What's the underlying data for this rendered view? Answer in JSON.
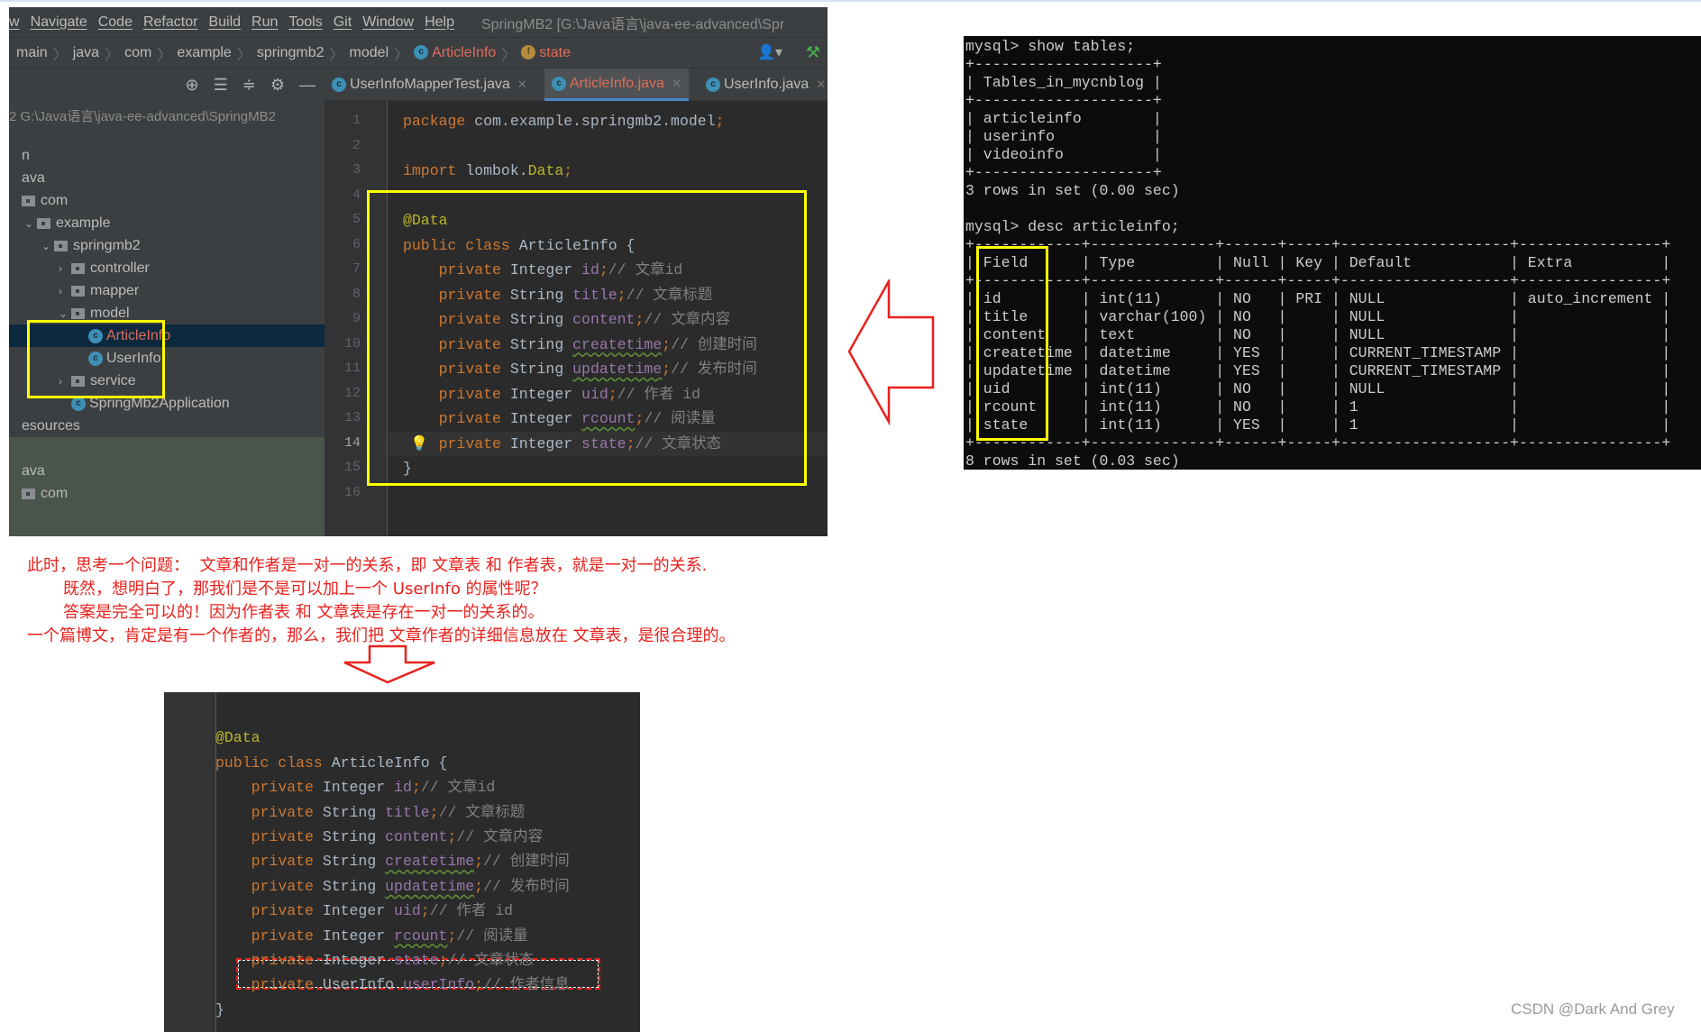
{
  "ide": {
    "menu": [
      "w",
      "Navigate",
      "Code",
      "Refactor",
      "Build",
      "Run",
      "Tools",
      "Git",
      "Window",
      "Help"
    ],
    "window_title": "SpringMB2 [G:\\Java语言\\java-ee-advanced\\Spr",
    "breadcrumb": [
      "main",
      "java",
      "com",
      "example",
      "springmb2",
      "model"
    ],
    "breadcrumb_class": "ArticleInfo",
    "breadcrumb_field": "state",
    "tabs": [
      {
        "label": "UserInfoMapperTest.java",
        "active": false
      },
      {
        "label": "ArticleInfo.java",
        "active": true
      },
      {
        "label": "UserInfo.java",
        "active": false
      }
    ],
    "project_path": "2  G:\\Java语言\\java-ee-advanced\\SpringMB2",
    "tree": [
      {
        "label": "n",
        "depth": 0,
        "kind": "text"
      },
      {
        "label": "ava",
        "depth": 0,
        "kind": "text"
      },
      {
        "label": "com",
        "depth": 0,
        "kind": "folder"
      },
      {
        "label": "example",
        "depth": 1,
        "kind": "folder",
        "chev": "open"
      },
      {
        "label": "springmb2",
        "depth": 2,
        "kind": "folder",
        "chev": "open"
      },
      {
        "label": "controller",
        "depth": 3,
        "kind": "folder",
        "chev": "closed"
      },
      {
        "label": "mapper",
        "depth": 3,
        "kind": "folder",
        "chev": "closed"
      },
      {
        "label": "model",
        "depth": 3,
        "kind": "folder",
        "chev": "open"
      },
      {
        "label": "ArticleInfo",
        "depth": 4,
        "kind": "class",
        "selected": true
      },
      {
        "label": "UserInfo",
        "depth": 4,
        "kind": "class"
      },
      {
        "label": "service",
        "depth": 3,
        "kind": "folder",
        "chev": "closed"
      },
      {
        "label": "SpringMb2Application",
        "depth": 3,
        "kind": "class"
      },
      {
        "label": "esources",
        "depth": 0,
        "kind": "text"
      },
      {
        "label": "",
        "depth": 0,
        "kind": "text"
      },
      {
        "label": "ava",
        "depth": 0,
        "kind": "text"
      },
      {
        "label": "com",
        "depth": 0,
        "kind": "folder"
      }
    ],
    "current_line": 14,
    "code": [
      [
        [
          "kw",
          "package"
        ],
        [
          "pl",
          " com.example.springmb2.model"
        ],
        [
          "kw",
          ";"
        ]
      ],
      [],
      [
        [
          "kw",
          "import"
        ],
        [
          "pl",
          " lombok."
        ],
        [
          "an",
          "Data"
        ],
        [
          "kw",
          ";"
        ]
      ],
      [],
      [
        [
          "an",
          "@Data"
        ]
      ],
      [
        [
          "kw",
          "public class "
        ],
        [
          "pl",
          "ArticleInfo {"
        ]
      ],
      [
        [
          "pl",
          "    "
        ],
        [
          "kw",
          "private "
        ],
        [
          "pl",
          "Integer "
        ],
        [
          "fd",
          "id"
        ],
        [
          "kw",
          ";"
        ],
        [
          "cm",
          "// 文章id"
        ]
      ],
      [
        [
          "pl",
          "    "
        ],
        [
          "kw",
          "private "
        ],
        [
          "pl",
          "String "
        ],
        [
          "fd",
          "title"
        ],
        [
          "kw",
          ";"
        ],
        [
          "cm",
          "// 文章标题"
        ]
      ],
      [
        [
          "pl",
          "    "
        ],
        [
          "kw",
          "private "
        ],
        [
          "pl",
          "String "
        ],
        [
          "fd",
          "content"
        ],
        [
          "kw",
          ";"
        ],
        [
          "cm",
          "// 文章内容"
        ]
      ],
      [
        [
          "pl",
          "    "
        ],
        [
          "kw",
          "private "
        ],
        [
          "pl",
          "String "
        ],
        [
          "fd typo",
          "createtime"
        ],
        [
          "kw",
          ";"
        ],
        [
          "cm",
          "// 创建时间"
        ]
      ],
      [
        [
          "pl",
          "    "
        ],
        [
          "kw",
          "private "
        ],
        [
          "pl",
          "String "
        ],
        [
          "fd typo",
          "updatetime"
        ],
        [
          "kw",
          ";"
        ],
        [
          "cm",
          "// 发布时间"
        ]
      ],
      [
        [
          "pl",
          "    "
        ],
        [
          "kw",
          "private "
        ],
        [
          "pl",
          "Integer "
        ],
        [
          "fd",
          "uid"
        ],
        [
          "kw",
          ";"
        ],
        [
          "cm",
          "// 作者 id"
        ]
      ],
      [
        [
          "pl",
          "    "
        ],
        [
          "kw",
          "private "
        ],
        [
          "pl",
          "Integer "
        ],
        [
          "fd typo",
          "rcount"
        ],
        [
          "kw",
          ";"
        ],
        [
          "cm",
          "// 阅读量"
        ]
      ],
      [
        [
          "pl",
          "    "
        ],
        [
          "kw",
          "private "
        ],
        [
          "pl",
          "Integer "
        ],
        [
          "fd",
          "state"
        ],
        [
          "kw",
          ";"
        ],
        [
          "cm",
          "// 文章状态"
        ]
      ],
      [
        [
          "pl",
          "}"
        ]
      ],
      []
    ]
  },
  "terminal": {
    "lines": [
      "mysql> show tables;",
      "+--------------------+",
      "| Tables_in_mycnblog |",
      "+--------------------+",
      "| articleinfo        |",
      "| userinfo           |",
      "| videoinfo          |",
      "+--------------------+",
      "3 rows in set (0.00 sec)",
      "",
      "mysql> desc articleinfo;",
      "+------------+--------------+------+-----+-------------------+----------------+",
      "| Field      | Type         | Null | Key | Default           | Extra          |",
      "+------------+--------------+------+-----+-------------------+----------------+",
      "| id         | int(11)      | NO   | PRI | NULL              | auto_increment |",
      "| title      | varchar(100) | NO   |     | NULL              |                |",
      "| content    | text         | NO   |     | NULL              |                |",
      "| createtime | datetime     | YES  |     | CURRENT_TIMESTAMP |                |",
      "| updatetime | datetime     | YES  |     | CURRENT_TIMESTAMP |                |",
      "| uid        | int(11)      | NO   |     | NULL              |                |",
      "| rcount     | int(11)      | NO   |     | 1                 |                |",
      "| state      | int(11)      | YES  |     | 1                 |                |",
      "+------------+--------------+------+-----+-------------------+----------------+",
      "8 rows in set (0.03 sec)"
    ]
  },
  "notes": [
    "此时，思考一个问题：  文章和作者是一对一的关系，即 文章表 和 作者表，就是一对一的关系.",
    "       既然，想明白了，那我们是不是可以加上一个 UserInfo 的属性呢？",
    "       答案是完全可以的！因为作者表 和 文章表是存在一对一的关系的。",
    "一个篇博文，肯定是有一个作者的，那么，我们把 文章作者的详细信息放在 文章表，是很合理的。"
  ],
  "code2": [
    [],
    [
      [
        "an",
        "@Data"
      ]
    ],
    [
      [
        "kw",
        "public class "
      ],
      [
        "pl",
        "ArticleInfo {"
      ]
    ],
    [
      [
        "pl",
        "    "
      ],
      [
        "kw",
        "private "
      ],
      [
        "pl",
        "Integer "
      ],
      [
        "fd",
        "id"
      ],
      [
        "kw",
        ";"
      ],
      [
        "cm",
        "// 文章id"
      ]
    ],
    [
      [
        "pl",
        "    "
      ],
      [
        "kw",
        "private "
      ],
      [
        "pl",
        "String "
      ],
      [
        "fd",
        "title"
      ],
      [
        "kw",
        ";"
      ],
      [
        "cm",
        "// 文章标题"
      ]
    ],
    [
      [
        "pl",
        "    "
      ],
      [
        "kw",
        "private "
      ],
      [
        "pl",
        "String "
      ],
      [
        "fd",
        "content"
      ],
      [
        "kw",
        ";"
      ],
      [
        "cm",
        "// 文章内容"
      ]
    ],
    [
      [
        "pl",
        "    "
      ],
      [
        "kw",
        "private "
      ],
      [
        "pl",
        "String "
      ],
      [
        "fd typo",
        "createtime"
      ],
      [
        "kw",
        ";"
      ],
      [
        "cm",
        "// 创建时间"
      ]
    ],
    [
      [
        "pl",
        "    "
      ],
      [
        "kw",
        "private "
      ],
      [
        "pl",
        "String "
      ],
      [
        "fd typo",
        "updatetime"
      ],
      [
        "kw",
        ";"
      ],
      [
        "cm",
        "// 发布时间"
      ]
    ],
    [
      [
        "pl",
        "    "
      ],
      [
        "kw",
        "private "
      ],
      [
        "pl",
        "Integer "
      ],
      [
        "fd",
        "uid"
      ],
      [
        "kw",
        ";"
      ],
      [
        "cm",
        "// 作者 id"
      ]
    ],
    [
      [
        "pl",
        "    "
      ],
      [
        "kw",
        "private "
      ],
      [
        "pl",
        "Integer "
      ],
      [
        "fd typo",
        "rcount"
      ],
      [
        "kw",
        ";"
      ],
      [
        "cm",
        "// 阅读量"
      ]
    ],
    [
      [
        "pl",
        "    "
      ],
      [
        "kw",
        "private "
      ],
      [
        "pl",
        "Integer "
      ],
      [
        "fd",
        "state"
      ],
      [
        "kw",
        ";"
      ],
      [
        "cm",
        "// 文章状态"
      ]
    ],
    [
      [
        "pl",
        "    "
      ],
      [
        "kw",
        "private "
      ],
      [
        "pl",
        "UserInfo "
      ],
      [
        "fd",
        "userInfo"
      ],
      [
        "kw",
        ";"
      ],
      [
        "cm",
        "// 作者信息"
      ]
    ],
    [
      [
        "pl",
        "}"
      ]
    ]
  ],
  "colors": {
    "annotation_red": "#e8211d",
    "highlight_yellow": "#ffff00"
  },
  "watermark": "CSDN @Dark And Grey"
}
